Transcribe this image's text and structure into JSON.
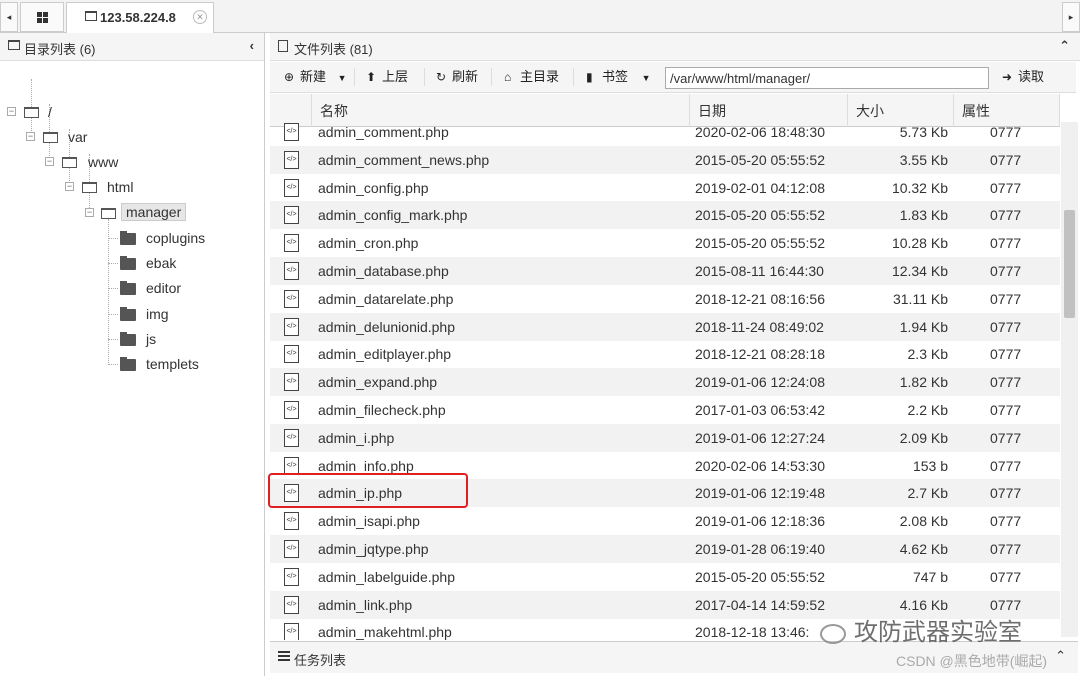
{
  "tabs": {
    "scroll_left": "◂",
    "scroll_right": "▸",
    "session_label": "123.58.224.8",
    "close": "✕"
  },
  "left": {
    "title": "目录列表 (6)",
    "collapse": "‹",
    "tree": {
      "root": "/",
      "var": "var",
      "www": "www",
      "html": "html",
      "manager": "manager",
      "children": [
        "coplugins",
        "ebak",
        "editor",
        "img",
        "js",
        "templets"
      ]
    }
  },
  "right": {
    "title": "文件列表 (81)",
    "collapse": "⌃",
    "toolbar": {
      "new": "新建",
      "up": "上层",
      "refresh": "刷新",
      "home": "主目录",
      "bookmark": "书签",
      "read": "读取",
      "path": "/var/www/html/manager/"
    },
    "columns": [
      "名称",
      "日期",
      "大小",
      "属性"
    ],
    "files": [
      {
        "name": "admin_comment.php",
        "date": "2020-02-06 18:48:30",
        "size": "5.73 Kb",
        "attr": "0777"
      },
      {
        "name": "admin_comment_news.php",
        "date": "2015-05-20 05:55:52",
        "size": "3.55 Kb",
        "attr": "0777"
      },
      {
        "name": "admin_config.php",
        "date": "2019-02-01 04:12:08",
        "size": "10.32 Kb",
        "attr": "0777"
      },
      {
        "name": "admin_config_mark.php",
        "date": "2015-05-20 05:55:52",
        "size": "1.83 Kb",
        "attr": "0777"
      },
      {
        "name": "admin_cron.php",
        "date": "2015-05-20 05:55:52",
        "size": "10.28 Kb",
        "attr": "0777"
      },
      {
        "name": "admin_database.php",
        "date": "2015-08-11 16:44:30",
        "size": "12.34 Kb",
        "attr": "0777"
      },
      {
        "name": "admin_datarelate.php",
        "date": "2018-12-21 08:16:56",
        "size": "31.11 Kb",
        "attr": "0777"
      },
      {
        "name": "admin_delunionid.php",
        "date": "2018-11-24 08:49:02",
        "size": "1.94 Kb",
        "attr": "0777"
      },
      {
        "name": "admin_editplayer.php",
        "date": "2018-12-21 08:28:18",
        "size": "2.3 Kb",
        "attr": "0777"
      },
      {
        "name": "admin_expand.php",
        "date": "2019-01-06 12:24:08",
        "size": "1.82 Kb",
        "attr": "0777"
      },
      {
        "name": "admin_filecheck.php",
        "date": "2017-01-03 06:53:42",
        "size": "2.2 Kb",
        "attr": "0777"
      },
      {
        "name": "admin_i.php",
        "date": "2019-01-06 12:27:24",
        "size": "2.09 Kb",
        "attr": "0777"
      },
      {
        "name": "admin_info.php",
        "date": "2020-02-06 14:53:30",
        "size": "153 b",
        "attr": "0777"
      },
      {
        "name": "admin_ip.php",
        "date": "2019-01-06 12:19:48",
        "size": "2.7 Kb",
        "attr": "0777"
      },
      {
        "name": "admin_isapi.php",
        "date": "2019-01-06 12:18:36",
        "size": "2.08 Kb",
        "attr": "0777"
      },
      {
        "name": "admin_jqtype.php",
        "date": "2019-01-28 06:19:40",
        "size": "4.62 Kb",
        "attr": "0777"
      },
      {
        "name": "admin_labelguide.php",
        "date": "2015-05-20 05:55:52",
        "size": "747 b",
        "attr": "0777"
      },
      {
        "name": "admin_link.php",
        "date": "2017-04-14 14:59:52",
        "size": "4.16 Kb",
        "attr": "0777"
      },
      {
        "name": "admin_makehtml.php",
        "date": "2018-12-18 13:46:",
        "size": "",
        "attr": ""
      }
    ]
  },
  "taskbar": {
    "label": "任务列表",
    "expand": "⌃"
  },
  "watermark": {
    "text": "攻防武器实验室",
    "csdn": "CSDN @黑色地带(崛起)"
  },
  "colors": {
    "highlight": "#e02020",
    "alt_row": "#f2f2f2"
  }
}
